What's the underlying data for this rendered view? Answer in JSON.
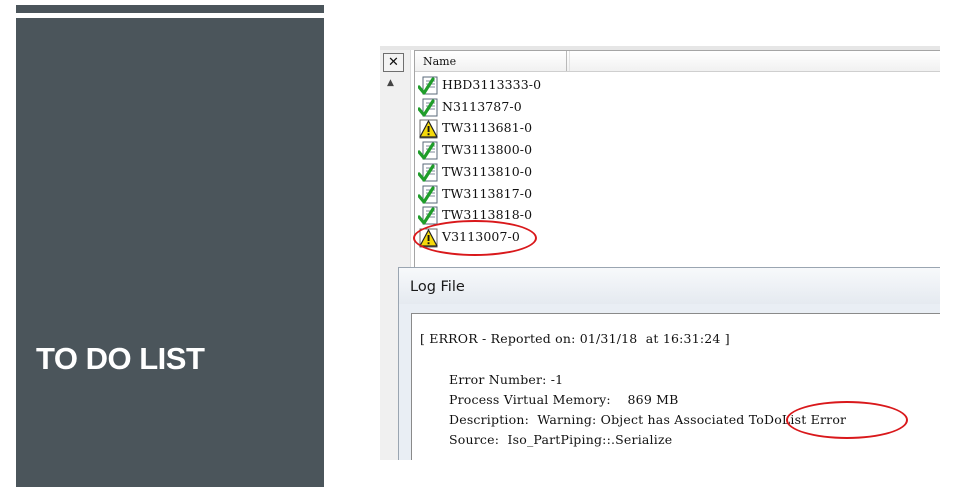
{
  "slide": {
    "title": "TO DO LIST",
    "panel_color": "#4b555b"
  },
  "list": {
    "column_header": "Name",
    "items": [
      {
        "name": "HBD3113333-0",
        "status": "ok",
        "icon": "checkmark-doc-icon"
      },
      {
        "name": "N3113787-0",
        "status": "ok",
        "icon": "checkmark-doc-icon"
      },
      {
        "name": "TW3113681-0",
        "status": "warning",
        "icon": "warning-icon"
      },
      {
        "name": "TW3113800-0",
        "status": "ok",
        "icon": "checkmark-doc-icon"
      },
      {
        "name": "TW3113810-0",
        "status": "ok",
        "icon": "checkmark-doc-icon"
      },
      {
        "name": "TW3113817-0",
        "status": "ok",
        "icon": "checkmark-doc-icon"
      },
      {
        "name": "TW3113818-0",
        "status": "ok",
        "icon": "checkmark-doc-icon"
      },
      {
        "name": "V3113007-0",
        "status": "warning",
        "icon": "warning-icon",
        "highlighted": true
      }
    ]
  },
  "log": {
    "title": "Log File",
    "header_line": "[ ERROR - Reported on: 01/31/18  at 16:31:24 ]",
    "error_number": "Error Number: -1",
    "memory": "Process Virtual Memory:    869 MB",
    "description_prefix": "Description:  Warning: Object has Associated ",
    "description_highlight": "ToDoList Error",
    "source": "Source:  Iso_PartPiping::.Serialize"
  },
  "colors": {
    "highlight_oval": "#d9181b",
    "check_green": "#1f9d2a",
    "warning_yellow": "#f5d90a"
  }
}
